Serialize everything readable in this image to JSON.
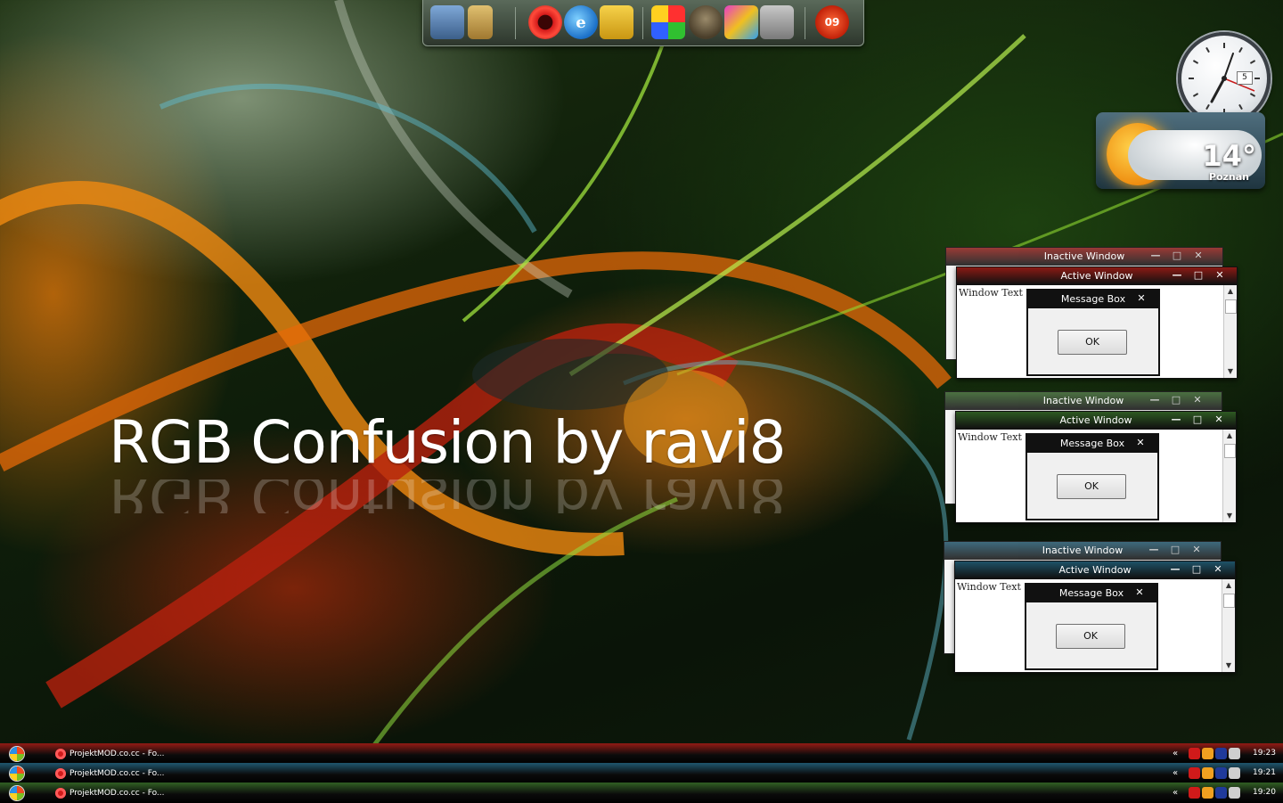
{
  "dock": {
    "icons": [
      "computer-icon",
      "folder-icon",
      "opera-icon",
      "internet-explorer-icon",
      "notepad-icon",
      "media-icon",
      "gimp-icon",
      "paint-icon",
      "tools-icon",
      "calendar-icon"
    ],
    "calendar_badge": "09"
  },
  "headline": "RGB Confusion by ravi8",
  "clock": {
    "date": "5"
  },
  "weather": {
    "temperature": "14°",
    "city": "Poznan"
  },
  "previews": [
    {
      "accent": "#8a1a14",
      "inactive_title": "Inactive Window",
      "active_title": "Active Window",
      "window_text": "Window Text",
      "msgbox_title": "Message Box",
      "ok_label": "OK"
    },
    {
      "accent": "#2e5a22",
      "inactive_title": "Inactive Window",
      "active_title": "Active Window",
      "window_text": "Window Text",
      "msgbox_title": "Message Box",
      "ok_label": "OK"
    },
    {
      "accent": "#1e5268",
      "inactive_title": "Inactive Window",
      "active_title": "Active Window",
      "window_text": "Window Text",
      "msgbox_title": "Message Box",
      "ok_label": "OK"
    }
  ],
  "taskbars": [
    {
      "accent": "#8a1a14",
      "task_label": "ProjektMOD.co.cc - Fo...",
      "time": "19:23"
    },
    {
      "accent": "#1e5268",
      "task_label": "ProjektMOD.co.cc - Fo...",
      "time": "19:21"
    },
    {
      "accent": "#2e5a22",
      "task_label": "ProjektMOD.co.cc - Fo...",
      "time": "19:20"
    }
  ],
  "tray": {
    "chevron": "«"
  }
}
